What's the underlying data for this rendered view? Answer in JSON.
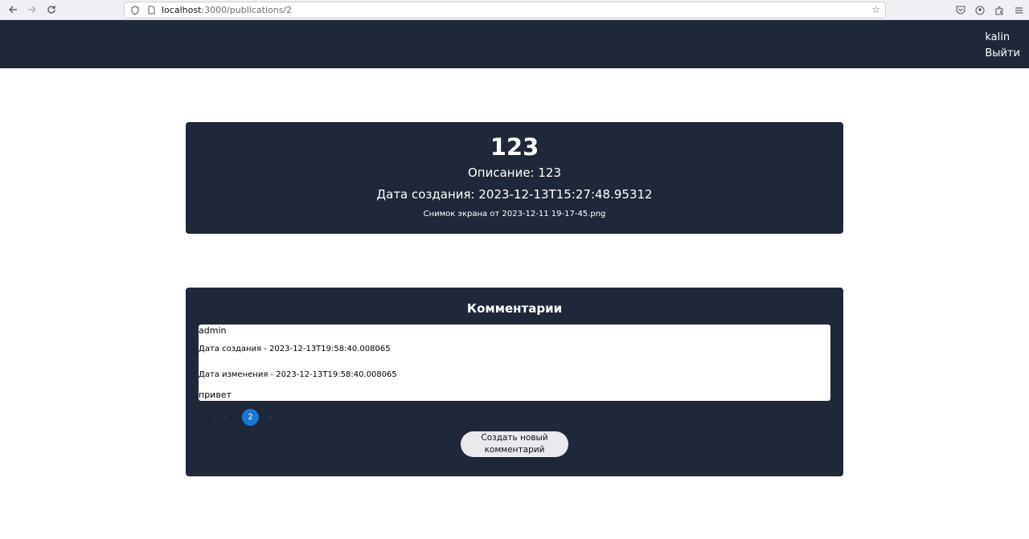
{
  "browser": {
    "url_host": "localhost",
    "url_path": ":3000/publications/2"
  },
  "header": {
    "username": "kalin",
    "logout_label": "Выйти"
  },
  "publication": {
    "title": "123",
    "description": "Описание: 123",
    "created": "Дата создания: 2023-12-13T15:27:48.95312",
    "file_name": "Снимок экрана от 2023-12-11 19-17-45.png"
  },
  "comments": {
    "title": "Комментарии",
    "items": [
      {
        "author": "admin",
        "created": "Дата создания - 2023-12-13T19:58:40.008065",
        "updated": "Дата изменения - 2023-12-13T19:58:40.008065",
        "text": "привет"
      }
    ],
    "pagination": {
      "prev_icon": "‹",
      "next_icon": "›",
      "pages": [
        "1",
        "2"
      ],
      "current_page": "2"
    },
    "create_button_label": "Создать новый комментарий"
  },
  "colors": {
    "header_bg": "#1f2839",
    "card_bg": "#1f2839",
    "active_page": "#1976d2"
  }
}
